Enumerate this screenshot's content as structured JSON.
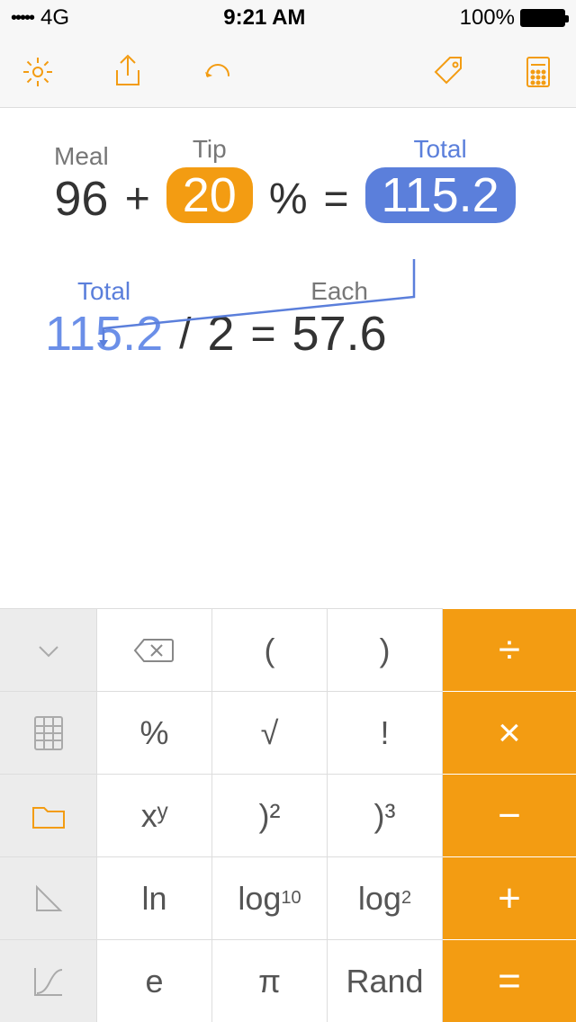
{
  "status": {
    "signal": "•••••",
    "carrier": "4G",
    "time": "9:21 AM",
    "battery": "100%"
  },
  "expr1": {
    "mealLabel": "Meal",
    "meal": "96",
    "plus": "+",
    "tipLabel": "Tip",
    "tip": "20",
    "percent": "%",
    "eq": "=",
    "totalLabel": "Total",
    "total": "115.2"
  },
  "expr2": {
    "totalLabel": "Total",
    "total": "115.2",
    "div": "/",
    "split": "2",
    "eq": "=",
    "eachLabel": "Each",
    "each": "57.6"
  },
  "keypad": {
    "r0": {
      "backspace": "⌫",
      "lparen": "(",
      "rparen": ")",
      "divide": "÷"
    },
    "r1": {
      "percent": "%",
      "sqrt": "√",
      "fact": "!",
      "times": "×"
    },
    "r2": {
      "pow": "xʸ",
      "sq": ")²",
      "cube": ")³",
      "minus": "−"
    },
    "r3": {
      "ln": "ln",
      "log10a": "log",
      "log10b": "10",
      "log2a": "log",
      "log2b": "2",
      "plus": "+"
    },
    "r4": {
      "e": "e",
      "pi": "π",
      "rand": "Rand",
      "eq": "="
    }
  }
}
